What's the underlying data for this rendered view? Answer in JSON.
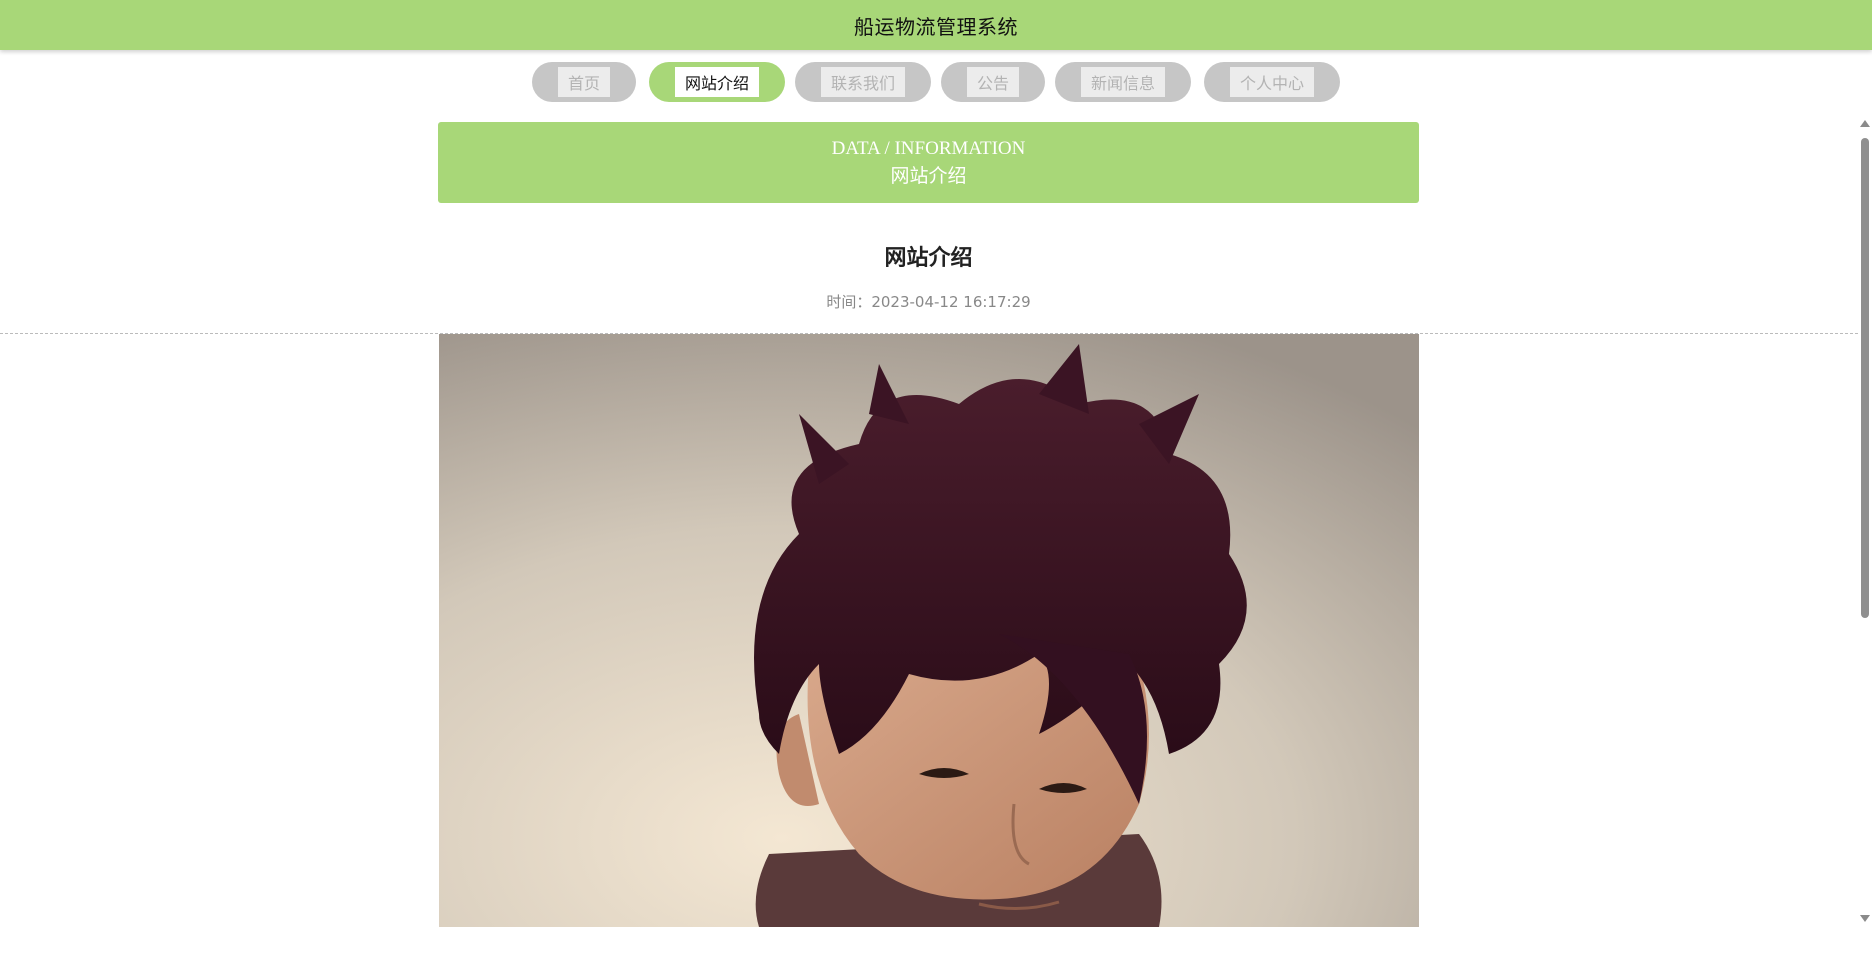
{
  "header": {
    "title": "船运物流管理系统"
  },
  "nav": {
    "items": [
      {
        "label": "首页",
        "active": false
      },
      {
        "label": "网站介绍",
        "active": true
      },
      {
        "label": "联系我们",
        "active": false
      },
      {
        "label": "公告",
        "active": false
      },
      {
        "label": "新闻信息",
        "active": false
      },
      {
        "label": "个人中心",
        "active": false
      }
    ]
  },
  "banner": {
    "en": "DATA / INFORMATION",
    "cn": "网站介绍"
  },
  "article": {
    "title": "网站介绍",
    "time": "时间：2023-04-12 16:17:29"
  },
  "colors": {
    "accent": "#a8d778",
    "pill_inactive": "#c6c6c6",
    "pill_label_inactive": "#b3b3b3"
  }
}
